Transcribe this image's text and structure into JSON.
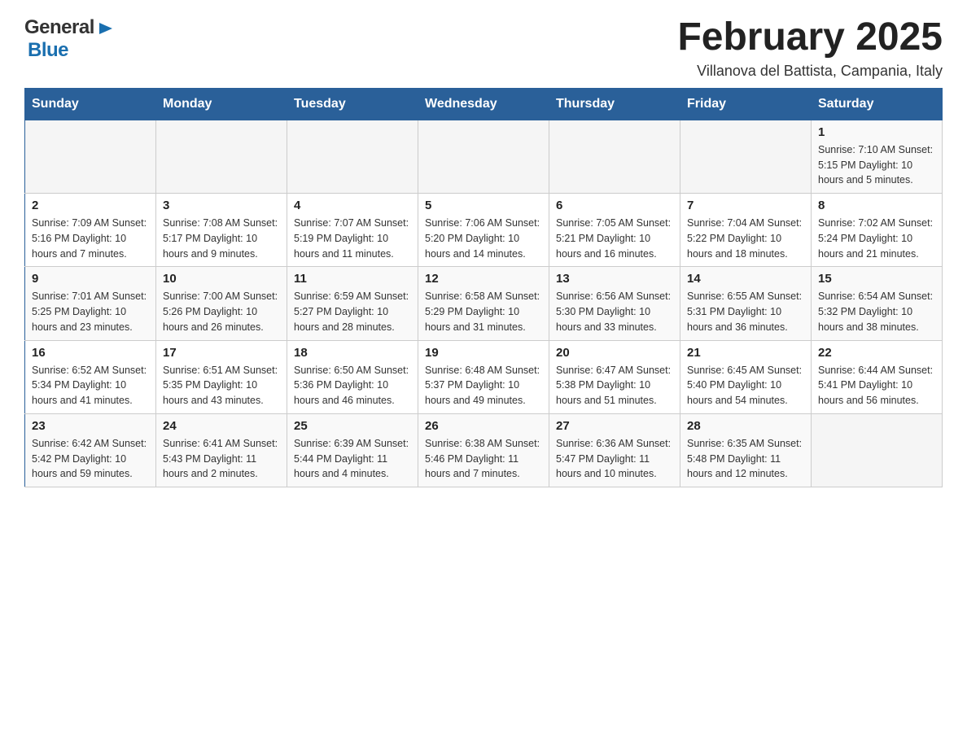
{
  "header": {
    "logo_general": "General",
    "logo_blue": "Blue",
    "title": "February 2025",
    "location": "Villanova del Battista, Campania, Italy"
  },
  "weekdays": [
    "Sunday",
    "Monday",
    "Tuesday",
    "Wednesday",
    "Thursday",
    "Friday",
    "Saturday"
  ],
  "weeks": [
    {
      "days": [
        {
          "number": "",
          "info": ""
        },
        {
          "number": "",
          "info": ""
        },
        {
          "number": "",
          "info": ""
        },
        {
          "number": "",
          "info": ""
        },
        {
          "number": "",
          "info": ""
        },
        {
          "number": "",
          "info": ""
        },
        {
          "number": "1",
          "info": "Sunrise: 7:10 AM\nSunset: 5:15 PM\nDaylight: 10 hours and 5 minutes."
        }
      ]
    },
    {
      "days": [
        {
          "number": "2",
          "info": "Sunrise: 7:09 AM\nSunset: 5:16 PM\nDaylight: 10 hours and 7 minutes."
        },
        {
          "number": "3",
          "info": "Sunrise: 7:08 AM\nSunset: 5:17 PM\nDaylight: 10 hours and 9 minutes."
        },
        {
          "number": "4",
          "info": "Sunrise: 7:07 AM\nSunset: 5:19 PM\nDaylight: 10 hours and 11 minutes."
        },
        {
          "number": "5",
          "info": "Sunrise: 7:06 AM\nSunset: 5:20 PM\nDaylight: 10 hours and 14 minutes."
        },
        {
          "number": "6",
          "info": "Sunrise: 7:05 AM\nSunset: 5:21 PM\nDaylight: 10 hours and 16 minutes."
        },
        {
          "number": "7",
          "info": "Sunrise: 7:04 AM\nSunset: 5:22 PM\nDaylight: 10 hours and 18 minutes."
        },
        {
          "number": "8",
          "info": "Sunrise: 7:02 AM\nSunset: 5:24 PM\nDaylight: 10 hours and 21 minutes."
        }
      ]
    },
    {
      "days": [
        {
          "number": "9",
          "info": "Sunrise: 7:01 AM\nSunset: 5:25 PM\nDaylight: 10 hours and 23 minutes."
        },
        {
          "number": "10",
          "info": "Sunrise: 7:00 AM\nSunset: 5:26 PM\nDaylight: 10 hours and 26 minutes."
        },
        {
          "number": "11",
          "info": "Sunrise: 6:59 AM\nSunset: 5:27 PM\nDaylight: 10 hours and 28 minutes."
        },
        {
          "number": "12",
          "info": "Sunrise: 6:58 AM\nSunset: 5:29 PM\nDaylight: 10 hours and 31 minutes."
        },
        {
          "number": "13",
          "info": "Sunrise: 6:56 AM\nSunset: 5:30 PM\nDaylight: 10 hours and 33 minutes."
        },
        {
          "number": "14",
          "info": "Sunrise: 6:55 AM\nSunset: 5:31 PM\nDaylight: 10 hours and 36 minutes."
        },
        {
          "number": "15",
          "info": "Sunrise: 6:54 AM\nSunset: 5:32 PM\nDaylight: 10 hours and 38 minutes."
        }
      ]
    },
    {
      "days": [
        {
          "number": "16",
          "info": "Sunrise: 6:52 AM\nSunset: 5:34 PM\nDaylight: 10 hours and 41 minutes."
        },
        {
          "number": "17",
          "info": "Sunrise: 6:51 AM\nSunset: 5:35 PM\nDaylight: 10 hours and 43 minutes."
        },
        {
          "number": "18",
          "info": "Sunrise: 6:50 AM\nSunset: 5:36 PM\nDaylight: 10 hours and 46 minutes."
        },
        {
          "number": "19",
          "info": "Sunrise: 6:48 AM\nSunset: 5:37 PM\nDaylight: 10 hours and 49 minutes."
        },
        {
          "number": "20",
          "info": "Sunrise: 6:47 AM\nSunset: 5:38 PM\nDaylight: 10 hours and 51 minutes."
        },
        {
          "number": "21",
          "info": "Sunrise: 6:45 AM\nSunset: 5:40 PM\nDaylight: 10 hours and 54 minutes."
        },
        {
          "number": "22",
          "info": "Sunrise: 6:44 AM\nSunset: 5:41 PM\nDaylight: 10 hours and 56 minutes."
        }
      ]
    },
    {
      "days": [
        {
          "number": "23",
          "info": "Sunrise: 6:42 AM\nSunset: 5:42 PM\nDaylight: 10 hours and 59 minutes."
        },
        {
          "number": "24",
          "info": "Sunrise: 6:41 AM\nSunset: 5:43 PM\nDaylight: 11 hours and 2 minutes."
        },
        {
          "number": "25",
          "info": "Sunrise: 6:39 AM\nSunset: 5:44 PM\nDaylight: 11 hours and 4 minutes."
        },
        {
          "number": "26",
          "info": "Sunrise: 6:38 AM\nSunset: 5:46 PM\nDaylight: 11 hours and 7 minutes."
        },
        {
          "number": "27",
          "info": "Sunrise: 6:36 AM\nSunset: 5:47 PM\nDaylight: 11 hours and 10 minutes."
        },
        {
          "number": "28",
          "info": "Sunrise: 6:35 AM\nSunset: 5:48 PM\nDaylight: 11 hours and 12 minutes."
        },
        {
          "number": "",
          "info": ""
        }
      ]
    }
  ]
}
